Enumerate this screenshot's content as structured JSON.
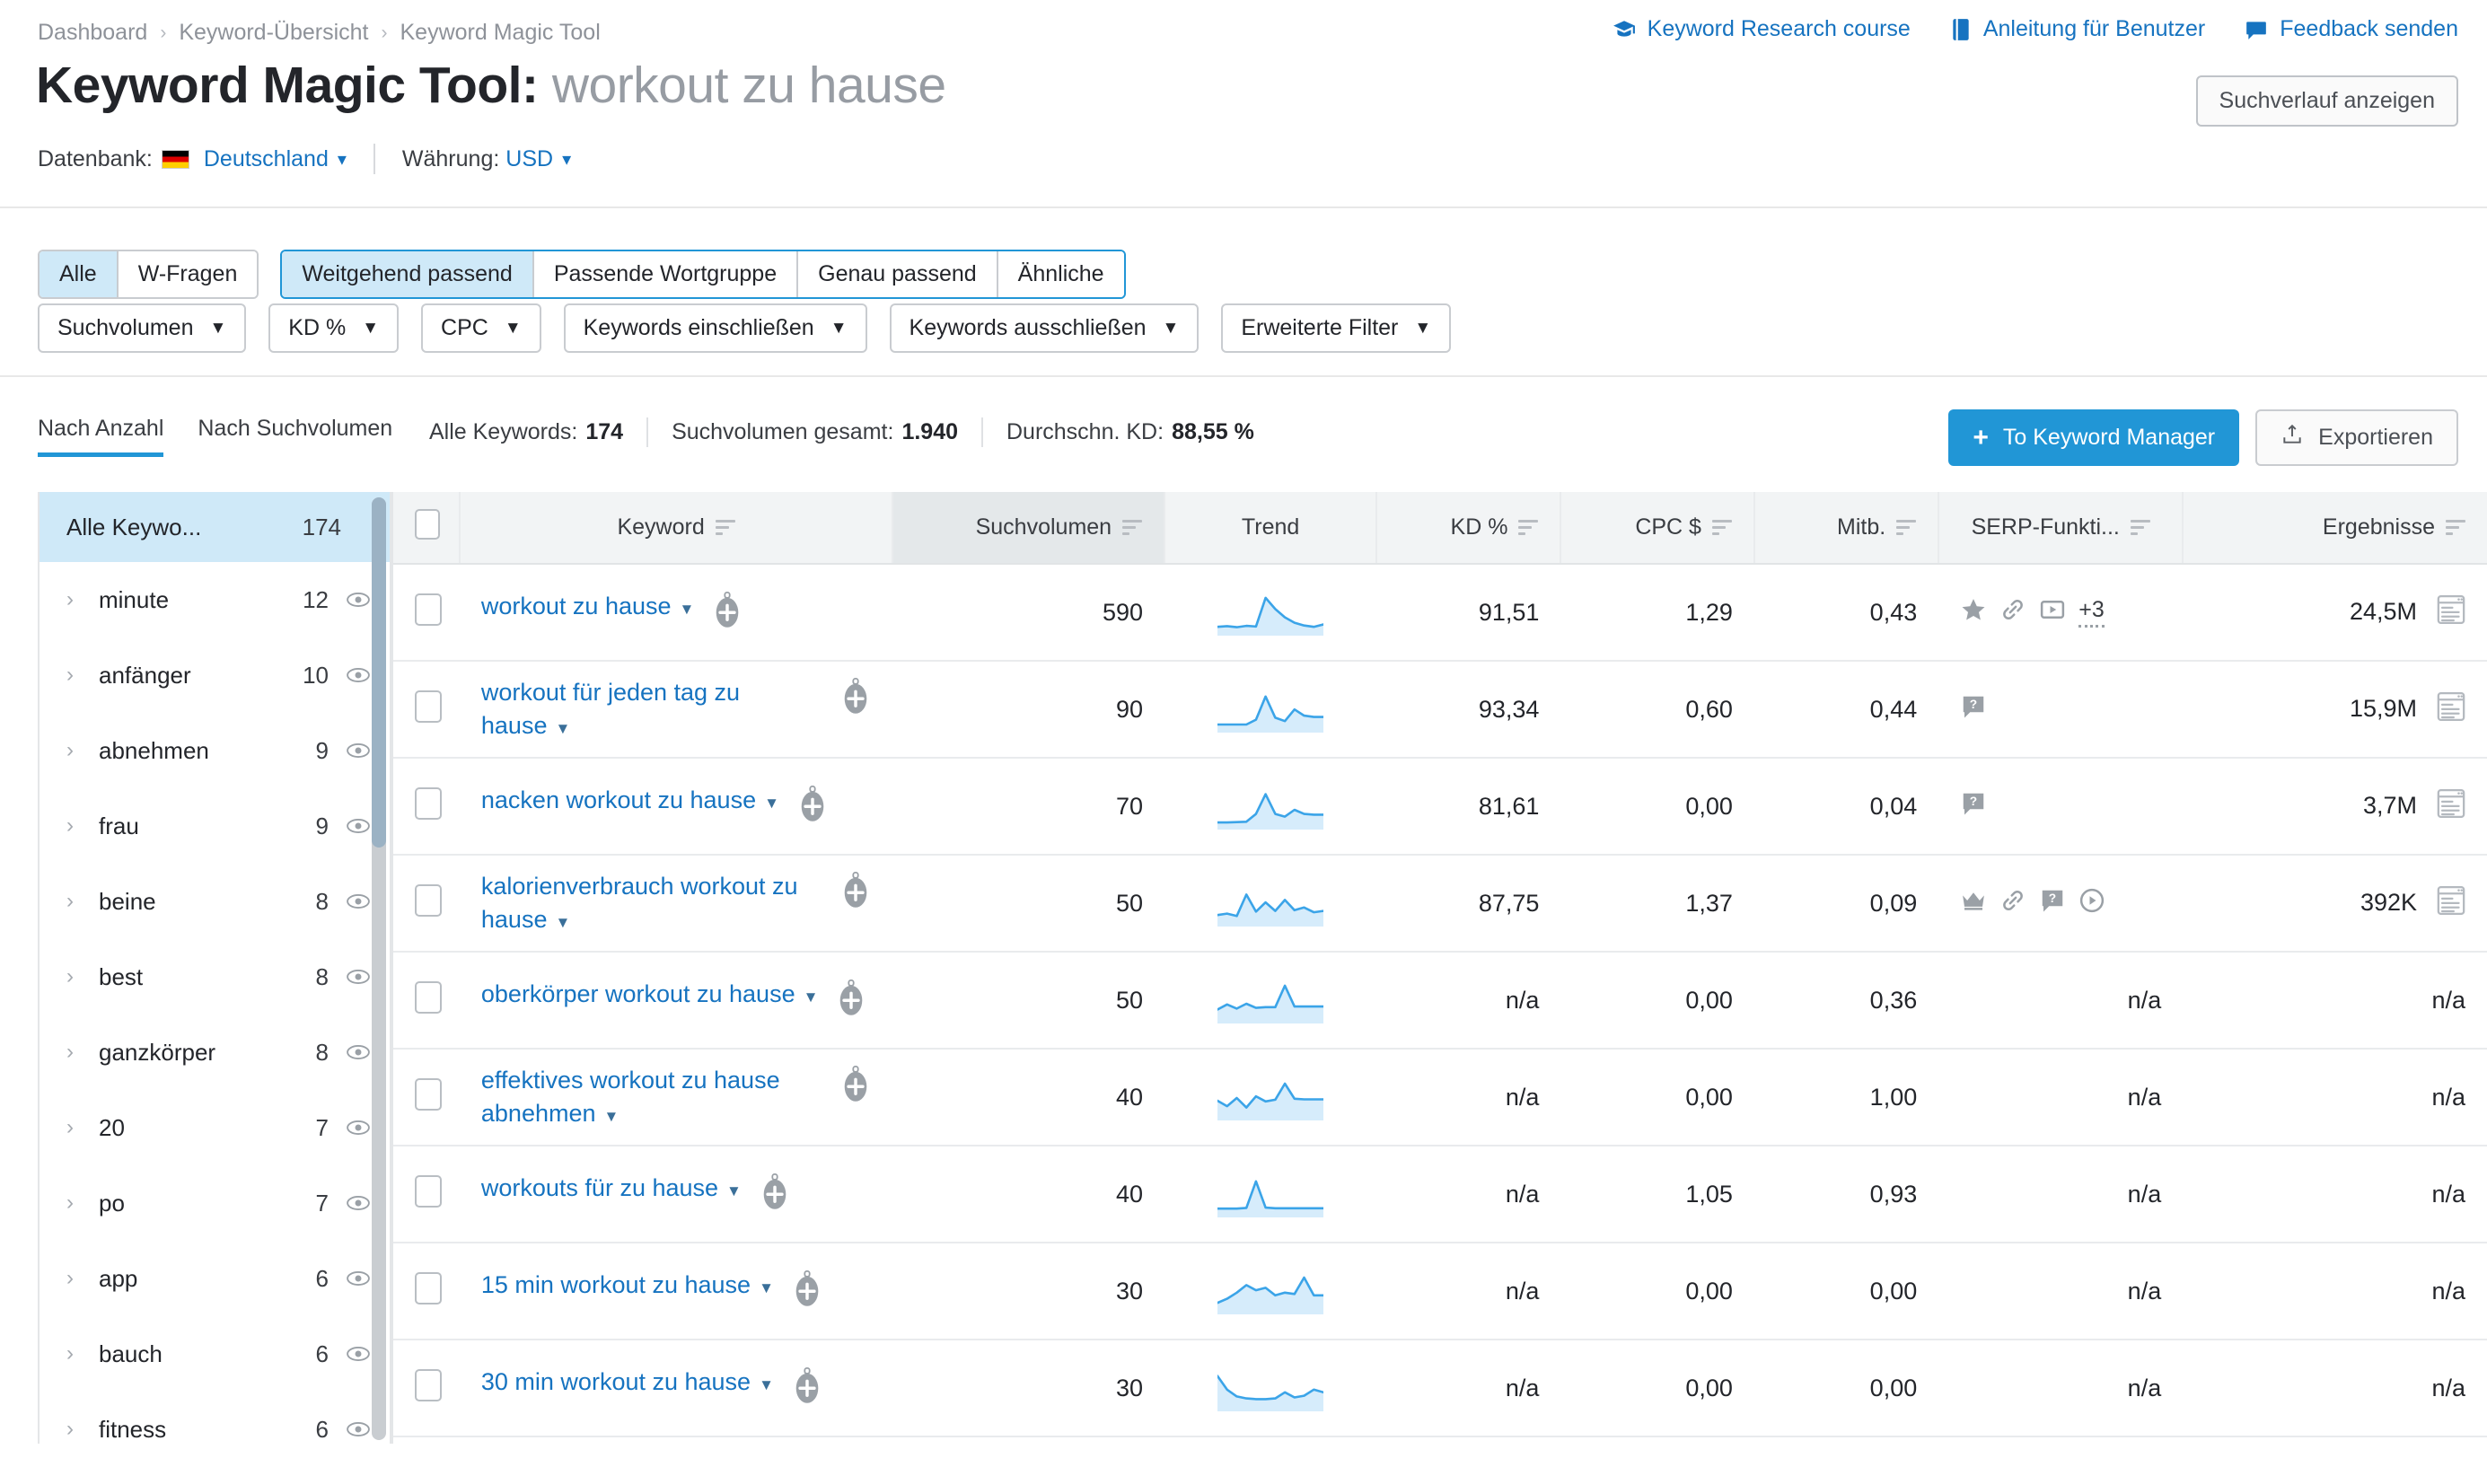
{
  "breadcrumb": [
    "Dashboard",
    "Keyword-Übersicht",
    "Keyword Magic Tool"
  ],
  "top_links": [
    {
      "label": "Keyword Research course",
      "icon": "graduation-cap-icon"
    },
    {
      "label": "Anleitung für Benutzer",
      "icon": "book-icon"
    },
    {
      "label": "Feedback senden",
      "icon": "speech-bubble-icon"
    }
  ],
  "header": {
    "title_prefix": "Keyword Magic Tool:",
    "query": "workout zu hause",
    "history_button": "Suchverlauf anzeigen",
    "database_label": "Datenbank:",
    "database_value": "Deutschland",
    "currency_label": "Währung:",
    "currency_value": "USD"
  },
  "filters": {
    "match_group_1": [
      {
        "label": "Alle",
        "active": true
      },
      {
        "label": "W-Fragen",
        "active": false
      }
    ],
    "match_group_2": [
      {
        "label": "Weitgehend passend",
        "active": true
      },
      {
        "label": "Passende Wortgruppe",
        "active": false
      },
      {
        "label": "Genau passend",
        "active": false
      },
      {
        "label": "Ähnliche",
        "active": false
      }
    ],
    "dropdowns": [
      "Suchvolumen",
      "KD %",
      "CPC",
      "Keywords einschließen",
      "Keywords ausschließen",
      "Erweiterte Filter"
    ]
  },
  "stats": {
    "view_tabs": [
      {
        "label": "Nach Anzahl",
        "active": true
      },
      {
        "label": "Nach Suchvolumen",
        "active": false
      }
    ],
    "all_keywords_label": "Alle Keywords:",
    "all_keywords_value": "174",
    "total_volume_label": "Suchvolumen gesamt:",
    "total_volume_value": "1.940",
    "avg_kd_label": "Durchschn. KD:",
    "avg_kd_value": "88,55 %",
    "to_keyword_manager": "To Keyword Manager",
    "export": "Exportieren"
  },
  "sidebar": {
    "header": {
      "label": "Alle Keywo...",
      "count": "174"
    },
    "items": [
      {
        "label": "minute",
        "count": "12"
      },
      {
        "label": "anfänger",
        "count": "10"
      },
      {
        "label": "abnehmen",
        "count": "9"
      },
      {
        "label": "frau",
        "count": "9"
      },
      {
        "label": "beine",
        "count": "8"
      },
      {
        "label": "best",
        "count": "8"
      },
      {
        "label": "ganzkörper",
        "count": "8"
      },
      {
        "label": "20",
        "count": "7"
      },
      {
        "label": "po",
        "count": "7"
      },
      {
        "label": "app",
        "count": "6"
      },
      {
        "label": "bauch",
        "count": "6"
      },
      {
        "label": "fitness",
        "count": "6"
      }
    ]
  },
  "table": {
    "columns": [
      {
        "key": "keyword",
        "label": "Keyword",
        "sortable": true,
        "align": "left"
      },
      {
        "key": "volume",
        "label": "Suchvolumen",
        "sortable": true,
        "align": "right",
        "sorted": true
      },
      {
        "key": "trend",
        "label": "Trend",
        "sortable": false,
        "align": "center"
      },
      {
        "key": "kd",
        "label": "KD %",
        "sortable": true,
        "align": "right"
      },
      {
        "key": "cpc",
        "label": "CPC $",
        "sortable": true,
        "align": "right"
      },
      {
        "key": "com",
        "label": "Mitb.",
        "sortable": true,
        "align": "right"
      },
      {
        "key": "serp",
        "label": "SERP-Funkti...",
        "sortable": true,
        "align": "left"
      },
      {
        "key": "results",
        "label": "Ergebnisse",
        "sortable": true,
        "align": "right"
      }
    ],
    "rows": [
      {
        "keyword": "workout zu hause",
        "volume": "590",
        "trend": [
          0.1,
          0.12,
          0.09,
          0.13,
          0.11,
          0.95,
          0.62,
          0.38,
          0.22,
          0.14,
          0.1,
          0.17
        ],
        "kd": "91,51",
        "cpc": "1,29",
        "com": "0,43",
        "serp": [
          "star-icon",
          "link-icon",
          "video-icon"
        ],
        "serp_more": "+3",
        "results": "24,5M"
      },
      {
        "keyword": "workout für jeden tag zu hause",
        "volume": "90",
        "trend": [
          0.08,
          0.08,
          0.08,
          0.08,
          0.22,
          0.9,
          0.28,
          0.18,
          0.52,
          0.34,
          0.3,
          0.3
        ],
        "kd": "93,34",
        "cpc": "0,60",
        "com": "0,44",
        "serp": [
          "question-icon"
        ],
        "serp_more": "",
        "results": "15,9M"
      },
      {
        "keyword": "nacken workout zu hause",
        "volume": "70",
        "trend": [
          0.05,
          0.05,
          0.06,
          0.07,
          0.3,
          0.88,
          0.3,
          0.22,
          0.42,
          0.3,
          0.28,
          0.28
        ],
        "kd": "81,61",
        "cpc": "0,00",
        "com": "0,04",
        "serp": [
          "question-icon"
        ],
        "serp_more": "",
        "results": "3,7M"
      },
      {
        "keyword": "kalorienverbrauch workout zu hause",
        "volume": "50",
        "trend": [
          0.18,
          0.22,
          0.15,
          0.78,
          0.28,
          0.55,
          0.3,
          0.62,
          0.32,
          0.4,
          0.26,
          0.3
        ],
        "kd": "87,75",
        "cpc": "1,37",
        "com": "0,09",
        "serp": [
          "crown-icon",
          "link-icon",
          "question-icon",
          "play-circle-icon"
        ],
        "serp_more": "",
        "results": "392K"
      },
      {
        "keyword": "oberkörper workout zu hause",
        "volume": "50",
        "trend": [
          0.25,
          0.4,
          0.28,
          0.42,
          0.3,
          0.32,
          0.32,
          0.95,
          0.34,
          0.34,
          0.34,
          0.34
        ],
        "kd": "n/a",
        "cpc": "0,00",
        "com": "0,36",
        "serp": [],
        "serp_more": "",
        "results": "n/a"
      },
      {
        "keyword": "effektives workout zu hause abnehmen",
        "volume": "40",
        "trend": [
          0.42,
          0.26,
          0.5,
          0.22,
          0.55,
          0.4,
          0.45,
          0.92,
          0.48,
          0.46,
          0.46,
          0.46
        ],
        "kd": "n/a",
        "cpc": "0,00",
        "com": "1,00",
        "serp": [],
        "serp_more": "",
        "results": "n/a"
      },
      {
        "keyword": "workouts für zu hause",
        "volume": "40",
        "trend": [
          0.1,
          0.1,
          0.1,
          0.12,
          0.9,
          0.13,
          0.11,
          0.11,
          0.11,
          0.11,
          0.11,
          0.11
        ],
        "kd": "n/a",
        "cpc": "1,05",
        "com": "0,93",
        "serp": [],
        "serp_more": "",
        "results": "n/a"
      },
      {
        "keyword": "15 min workout zu hause",
        "volume": "30",
        "trend": [
          0.18,
          0.3,
          0.48,
          0.7,
          0.55,
          0.62,
          0.4,
          0.48,
          0.44,
          0.92,
          0.4,
          0.4
        ],
        "kd": "n/a",
        "cpc": "0,00",
        "com": "0,00",
        "serp": [],
        "serp_more": "",
        "results": "n/a"
      },
      {
        "keyword": "30 min workout zu hause",
        "volume": "30",
        "trend": [
          0.88,
          0.48,
          0.28,
          0.22,
          0.2,
          0.2,
          0.22,
          0.4,
          0.25,
          0.3,
          0.48,
          0.4
        ],
        "kd": "n/a",
        "cpc": "0,00",
        "com": "0,00",
        "serp": [],
        "serp_more": "",
        "results": "n/a"
      }
    ]
  },
  "colors": {
    "accent": "#2196d6",
    "link": "#1673c0",
    "active_bg": "#cfe9f8",
    "spark_line": "#3ba4e8",
    "spark_fill": "#d6ecfb"
  }
}
